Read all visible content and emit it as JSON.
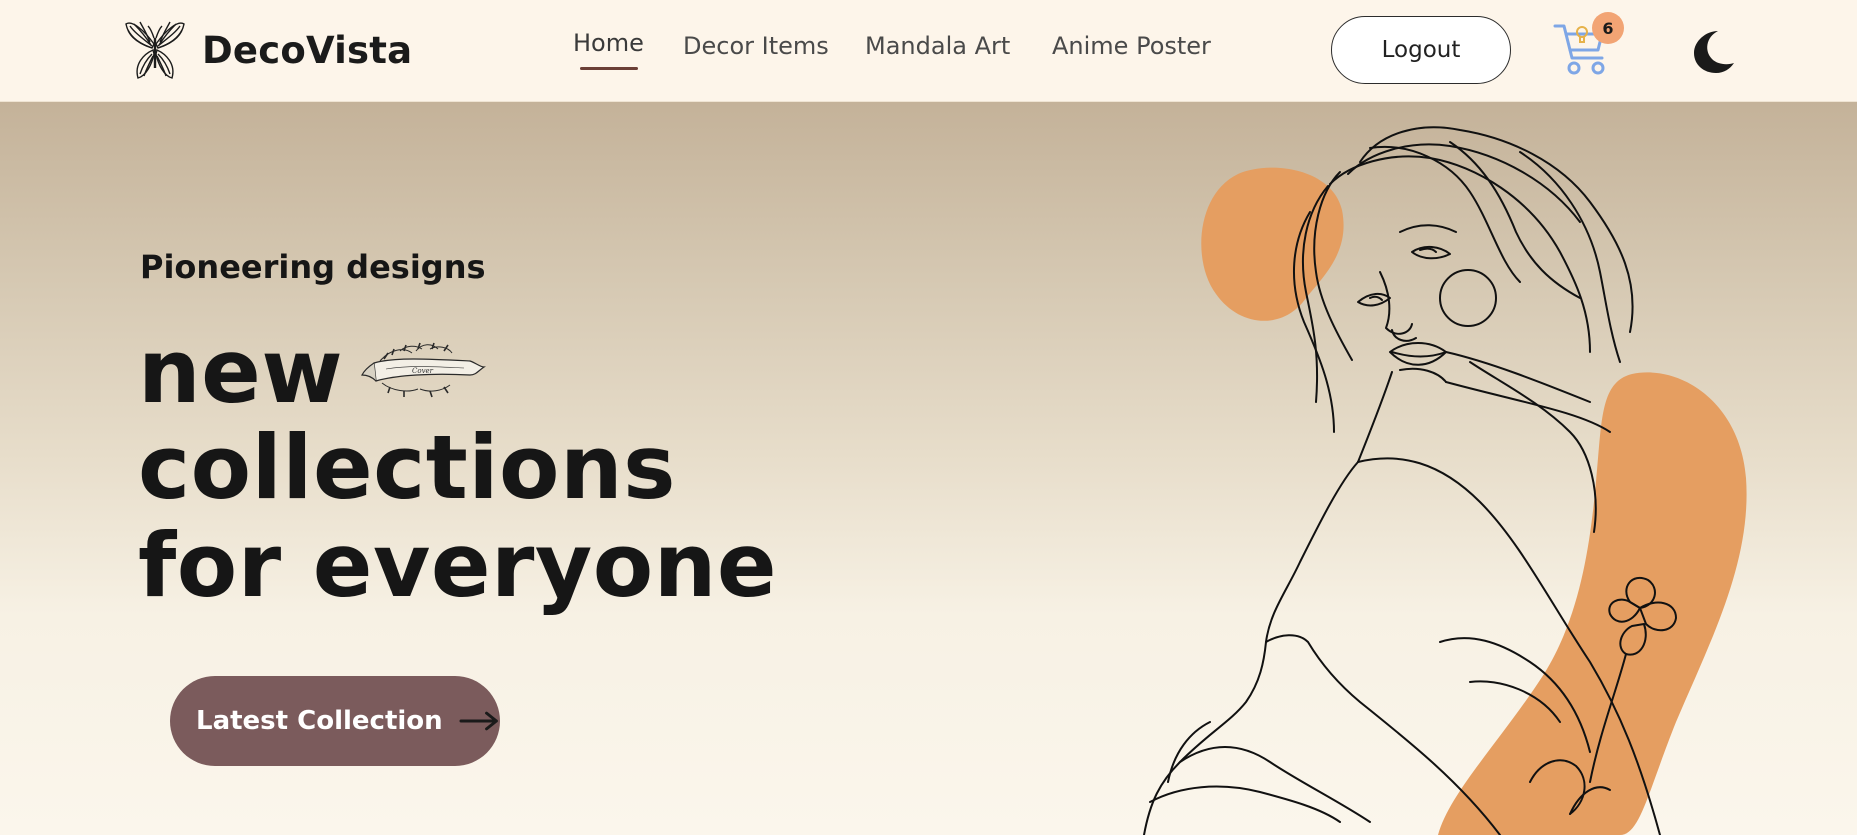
{
  "header": {
    "brand_name": "DecoVista",
    "logo_icon": "butterfly-icon",
    "nav": [
      {
        "label": "Home",
        "active": true
      },
      {
        "label": "Decor Items",
        "active": false
      },
      {
        "label": "Mandala Art",
        "active": false
      },
      {
        "label": "Anime Poster",
        "active": false
      }
    ],
    "logout_label": "Logout",
    "cart_icon": "shopping-cart-icon",
    "cart_count": "6",
    "theme_icon": "moon-icon"
  },
  "hero": {
    "kicker": "Pioneering designs",
    "title_lines": [
      "new",
      "collections",
      "for everyone"
    ],
    "ribbon_icon": "vintage-ribbon-banner-icon",
    "cta_label": "Latest Collection",
    "cta_icon": "arrow-right-icon",
    "art": "line-art-woman-illustration"
  },
  "colors": {
    "header_bg": "#fdf5ea",
    "accent": "#6b3f36",
    "cta_bg": "#7b5b5c",
    "badge": "#f2a474",
    "cart_blue": "#7ea6e6",
    "art_orange": "#e59e61",
    "text_dark": "#161616"
  }
}
